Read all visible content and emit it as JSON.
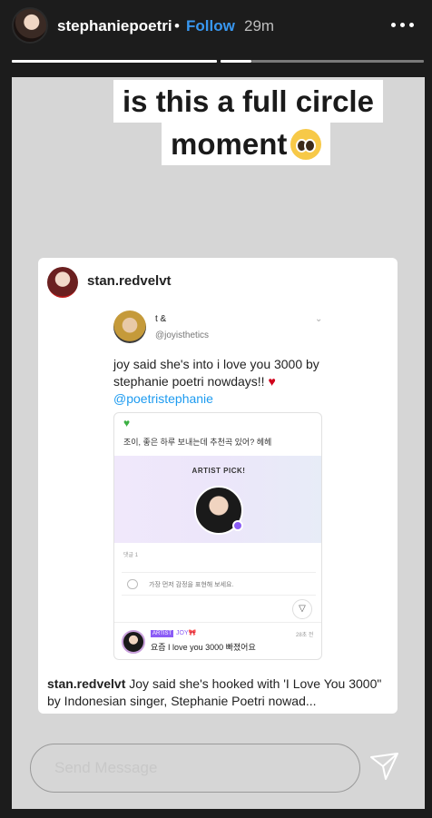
{
  "header": {
    "username": "stephaniepoetri",
    "separator": "•",
    "follow_label": "Follow",
    "time": "29m"
  },
  "progress": {
    "segments": 3,
    "current_segment_fraction": 0.15
  },
  "story": {
    "caption_line1": "is this a full circle",
    "caption_line2": "moment",
    "caption_emoji": "pleading-face-icon",
    "post": {
      "username": "stan.redvelvt",
      "tweet": {
        "name": "t &",
        "handle": "@joyisthetics",
        "text": "joy said she's into i love you 3000 by stephanie poetri nowdays!!",
        "heart": "♥",
        "mention": "@poetristephanie",
        "inner": {
          "green_heart": "♥",
          "korean_line": "조이, 좋은 하루 보내는데 추천곡 있어? 헤헤",
          "pick_title": "ARTIST PICK!",
          "comment_count": "댓글 1",
          "comment_placeholder": "가장 먼저 감정을 표현해 보세요.",
          "reply_tag": "ARTIST",
          "reply_name": "JOY🎀",
          "reply_time": "28초 전",
          "reply_text": "요즘 I love you 3000 빠졌어요"
        }
      },
      "caption_user": "stan.redvelvt",
      "caption_text": "Joy said she's hooked with 'I Love You 3000\" by Indonesian singer, Stephanie Poetri nowad..."
    }
  },
  "footer": {
    "message_placeholder": "Send Message"
  },
  "colors": {
    "follow": "#3897f0",
    "background": "#1c1c1c"
  }
}
